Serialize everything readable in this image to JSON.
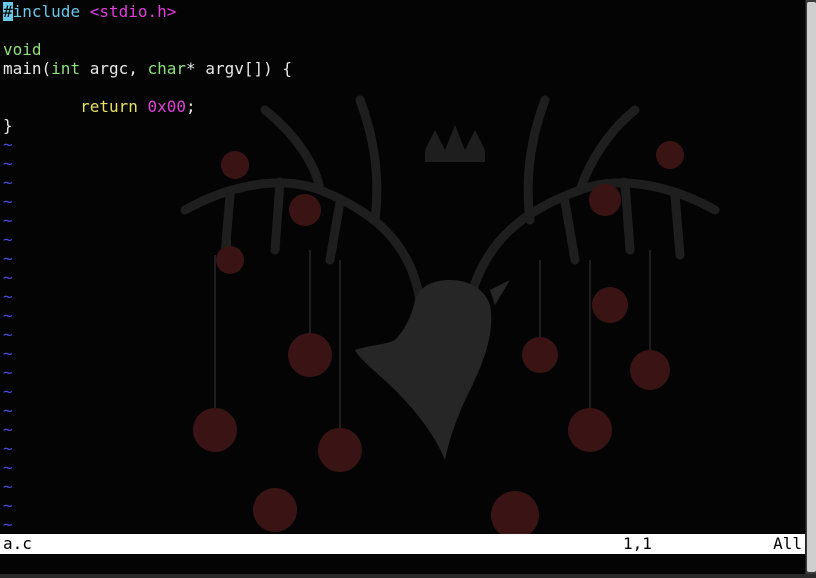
{
  "editor": {
    "line1": {
      "hash": "#",
      "directive": "include",
      "header": "<stdio.h>"
    },
    "line3": {
      "type": "void"
    },
    "line4": {
      "func": "main(",
      "t1": "int",
      "a1": " argc, ",
      "t2": "char",
      "a2": "* argv[]) {"
    },
    "line6": {
      "indent": "        ",
      "keyword": "return",
      "space": " ",
      "number": "0x00",
      "semi": ";"
    },
    "line7": {
      "brace": "}"
    },
    "tilde": "~",
    "tilde_count": 21
  },
  "statusbar": {
    "filename": "a.c",
    "position": "1,1",
    "scroll": "All"
  },
  "colors": {
    "background": "#040404",
    "preprocessor": "#69c8e8",
    "string": "#e040d8",
    "type": "#8ee07a",
    "keyword": "#e8e060",
    "tilde": "#4a4ae0"
  },
  "wallpaper_icon": "stag-antlers-wallpaper-icon"
}
